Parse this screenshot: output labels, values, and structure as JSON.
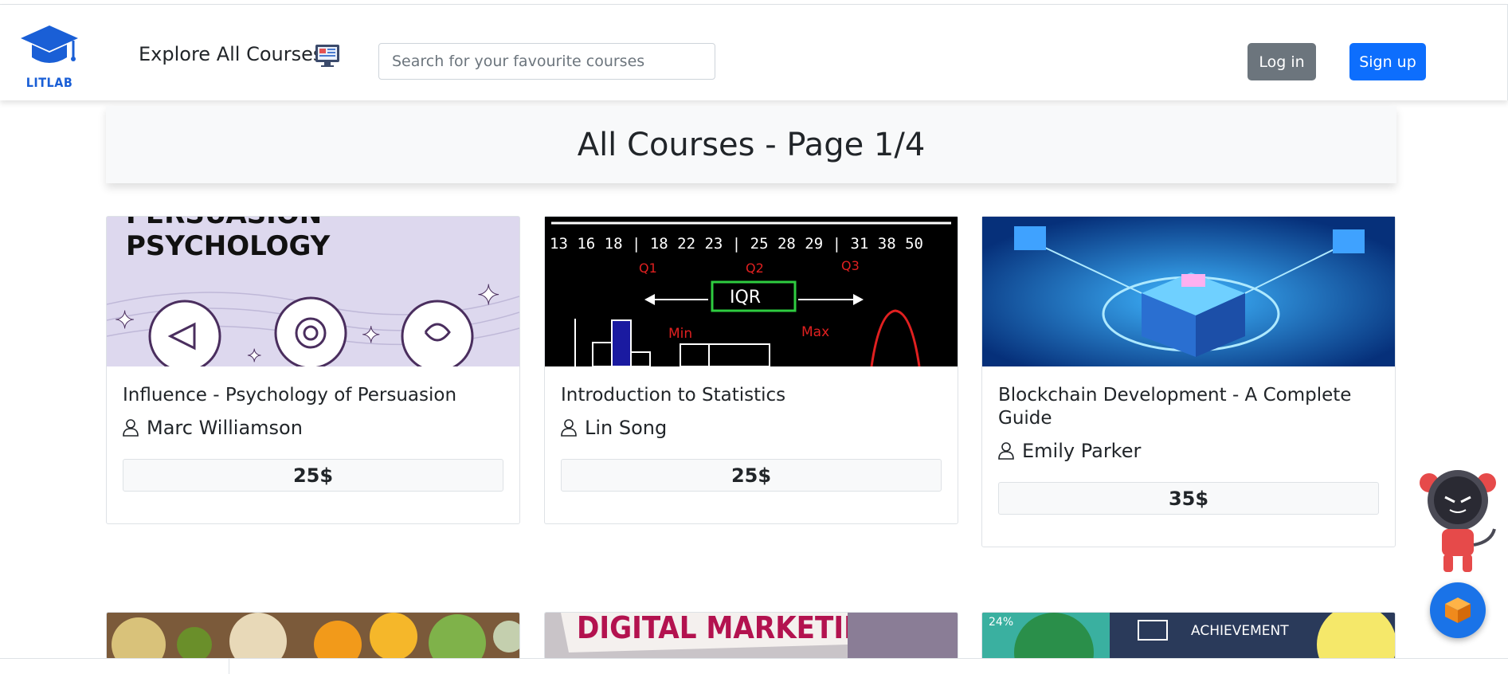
{
  "navbar": {
    "logo_text": "LITLAB",
    "explore_label": "Explore All Courses",
    "search_placeholder": "Search for your favourite courses",
    "login_label": "Log in",
    "signup_label": "Sign up"
  },
  "page": {
    "heading": "All Courses - Page 1/4"
  },
  "courses": [
    {
      "title": "Influence - Psychology of Persuasion",
      "author": "Marc Williamson",
      "price": "25$",
      "image_text": [
        "PERSUASION",
        "PSYCHOLOGY"
      ]
    },
    {
      "title": "Introduction to Statistics",
      "author": "Lin Song",
      "price": "25$",
      "image_text": [
        "13 16 18 | 18 22 23 | 25 28 29 | 31 38 50",
        "Q1",
        "Q2",
        "Q3",
        "IQR",
        "Min",
        "Max"
      ]
    },
    {
      "title": "Blockchain Development - A Complete Guide",
      "author": "Emily Parker",
      "price": "35$",
      "image_text": []
    }
  ],
  "next_row": [
    {
      "image_text": ""
    },
    {
      "image_text": "DIGITAL MARKETING"
    },
    {
      "image_text": "ACHIEVEMENT",
      "percent": "24%"
    }
  ],
  "colors": {
    "primary": "#0d6efd",
    "secondary": "#6c757d",
    "logo_blue": "#1a5fd6"
  }
}
